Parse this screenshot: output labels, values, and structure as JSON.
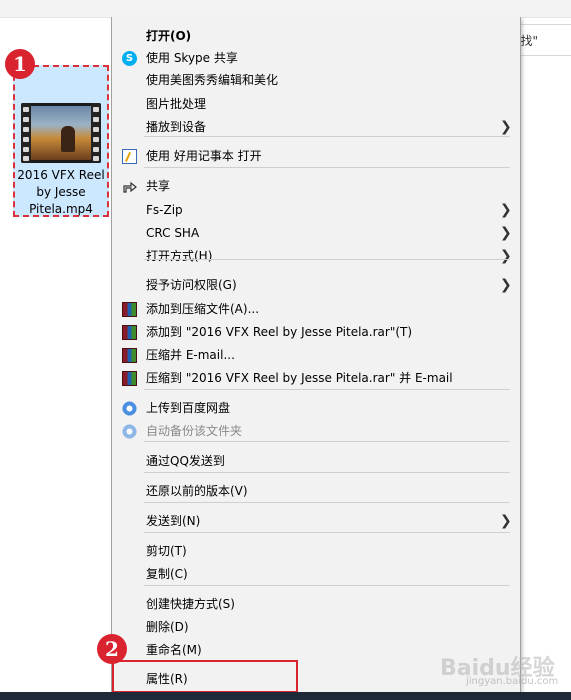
{
  "search": {
    "text": "\"找\""
  },
  "file": {
    "name": "2016 VFX Reel by Jesse Pitela.mp4"
  },
  "badges": {
    "one": "1",
    "two": "2"
  },
  "menu": {
    "items": [
      {
        "label": "打开(O)",
        "icon": "none",
        "submenu": false,
        "bold": true,
        "disabled": false
      },
      {
        "label": "使用 Skype 共享",
        "icon": "skype-icon",
        "submenu": false,
        "bold": false,
        "disabled": false
      },
      {
        "label": "使用美图秀秀编辑和美化",
        "icon": "none",
        "submenu": false,
        "bold": false,
        "disabled": false
      },
      {
        "label": "图片批处理",
        "icon": "none",
        "submenu": false,
        "bold": false,
        "disabled": false
      },
      {
        "label": "播放到设备",
        "icon": "none",
        "submenu": true,
        "bold": false,
        "disabled": false
      },
      {
        "label": "使用 好用记事本 打开",
        "icon": "notepad-icon",
        "submenu": false,
        "bold": false,
        "disabled": false
      },
      {
        "label": "共享",
        "icon": "share-icon",
        "submenu": false,
        "bold": false,
        "disabled": false
      },
      {
        "label": "Fs-Zip",
        "icon": "none",
        "submenu": true,
        "bold": false,
        "disabled": false
      },
      {
        "label": "CRC SHA",
        "icon": "none",
        "submenu": true,
        "bold": false,
        "disabled": false
      },
      {
        "label": "打开方式(H)",
        "icon": "none",
        "submenu": true,
        "bold": false,
        "disabled": false
      },
      {
        "label": "授予访问权限(G)",
        "icon": "none",
        "submenu": true,
        "bold": false,
        "disabled": false
      },
      {
        "label": "添加到压缩文件(A)...",
        "icon": "winrar-icon",
        "submenu": false,
        "bold": false,
        "disabled": false
      },
      {
        "label": "添加到 \"2016 VFX Reel by Jesse Pitela.rar\"(T)",
        "icon": "winrar-icon",
        "submenu": false,
        "bold": false,
        "disabled": false
      },
      {
        "label": "压缩并 E-mail...",
        "icon": "winrar-icon",
        "submenu": false,
        "bold": false,
        "disabled": false
      },
      {
        "label": "压缩到 \"2016 VFX Reel by Jesse Pitela.rar\" 并 E-mail",
        "icon": "winrar-icon",
        "submenu": false,
        "bold": false,
        "disabled": false
      },
      {
        "label": "上传到百度网盘",
        "icon": "baidu-cloud-icon",
        "submenu": false,
        "bold": false,
        "disabled": false
      },
      {
        "label": "自动备份该文件夹",
        "icon": "baidu-cloud-icon",
        "submenu": false,
        "bold": false,
        "disabled": true
      },
      {
        "label": "通过QQ发送到",
        "icon": "none",
        "submenu": false,
        "bold": false,
        "disabled": false
      },
      {
        "label": "还原以前的版本(V)",
        "icon": "none",
        "submenu": false,
        "bold": false,
        "disabled": false
      },
      {
        "label": "发送到(N)",
        "icon": "none",
        "submenu": true,
        "bold": false,
        "disabled": false
      },
      {
        "label": "剪切(T)",
        "icon": "none",
        "submenu": false,
        "bold": false,
        "disabled": false
      },
      {
        "label": "复制(C)",
        "icon": "none",
        "submenu": false,
        "bold": false,
        "disabled": false
      },
      {
        "label": "创建快捷方式(S)",
        "icon": "none",
        "submenu": false,
        "bold": false,
        "disabled": false
      },
      {
        "label": "删除(D)",
        "icon": "none",
        "submenu": false,
        "bold": false,
        "disabled": false
      },
      {
        "label": "重命名(M)",
        "icon": "none",
        "submenu": false,
        "bold": false,
        "disabled": false
      },
      {
        "label": "属性(R)",
        "icon": "none",
        "submenu": false,
        "bold": false,
        "disabled": false
      }
    ]
  },
  "watermark": {
    "text": "Baidu经验",
    "sub": "jingyan.baidu.com"
  },
  "colors": {
    "accent": "#d9232e",
    "selection": "#cce8ff",
    "menu_bg": "#f2f2f2"
  }
}
